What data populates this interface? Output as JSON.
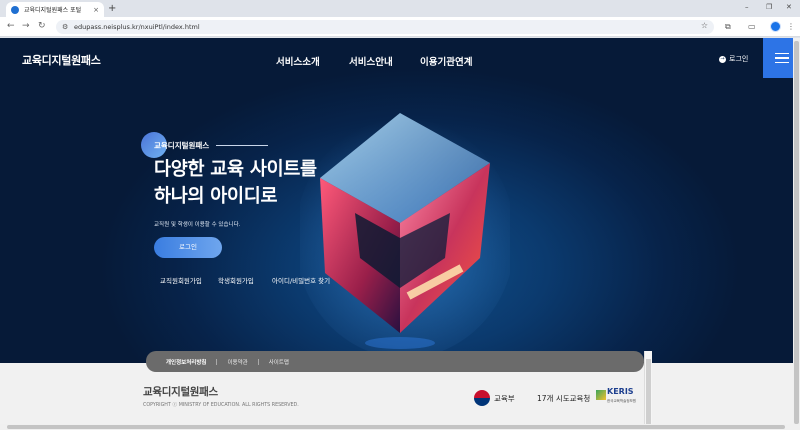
{
  "browser": {
    "tab_title": "교육디지털원패스 포털",
    "tab_close": "×",
    "new_tab": "+",
    "url": "edupass.neisplus.kr/nxuiPtl/index.html",
    "nav": {
      "back": "←",
      "forward": "→",
      "reload": "↻"
    },
    "window": {
      "minimize": "–",
      "maximize": "❐",
      "close": "✕"
    }
  },
  "header": {
    "logo": "교육디지털원패스",
    "nav": [
      "서비스소개",
      "서비스안내",
      "이용기관연계"
    ],
    "login": "로그인"
  },
  "hero": {
    "badge": "교육디지털원패스",
    "headline_1": "다양한 교육 사이트를",
    "headline_2": "하나의 아이디로",
    "subtext": "교직원 및 학생이 이용할 수 있습니다.",
    "login_button": "로그인",
    "quick_links": [
      "교직원회원가입",
      "학생회원가입",
      "아이디/비밀번호 찾기"
    ]
  },
  "footer": {
    "links": [
      "개인정보처리방침",
      "이용약관",
      "사이트맵"
    ],
    "logo": "교육디지털원패스",
    "copyright": "COPYRIGHT ⓒ MINISTRY OF EDUCATION. ALL RIGHTS RESERVED.",
    "moe": "교육부",
    "sido": "17개 시도교육청",
    "keris": "KERIS",
    "keris_sub": "한국교육학술정보원"
  },
  "colors": {
    "hero_bg": "#0b3a6e",
    "accent": "#2d74e6",
    "footer_bar": "#6b6b6b"
  }
}
